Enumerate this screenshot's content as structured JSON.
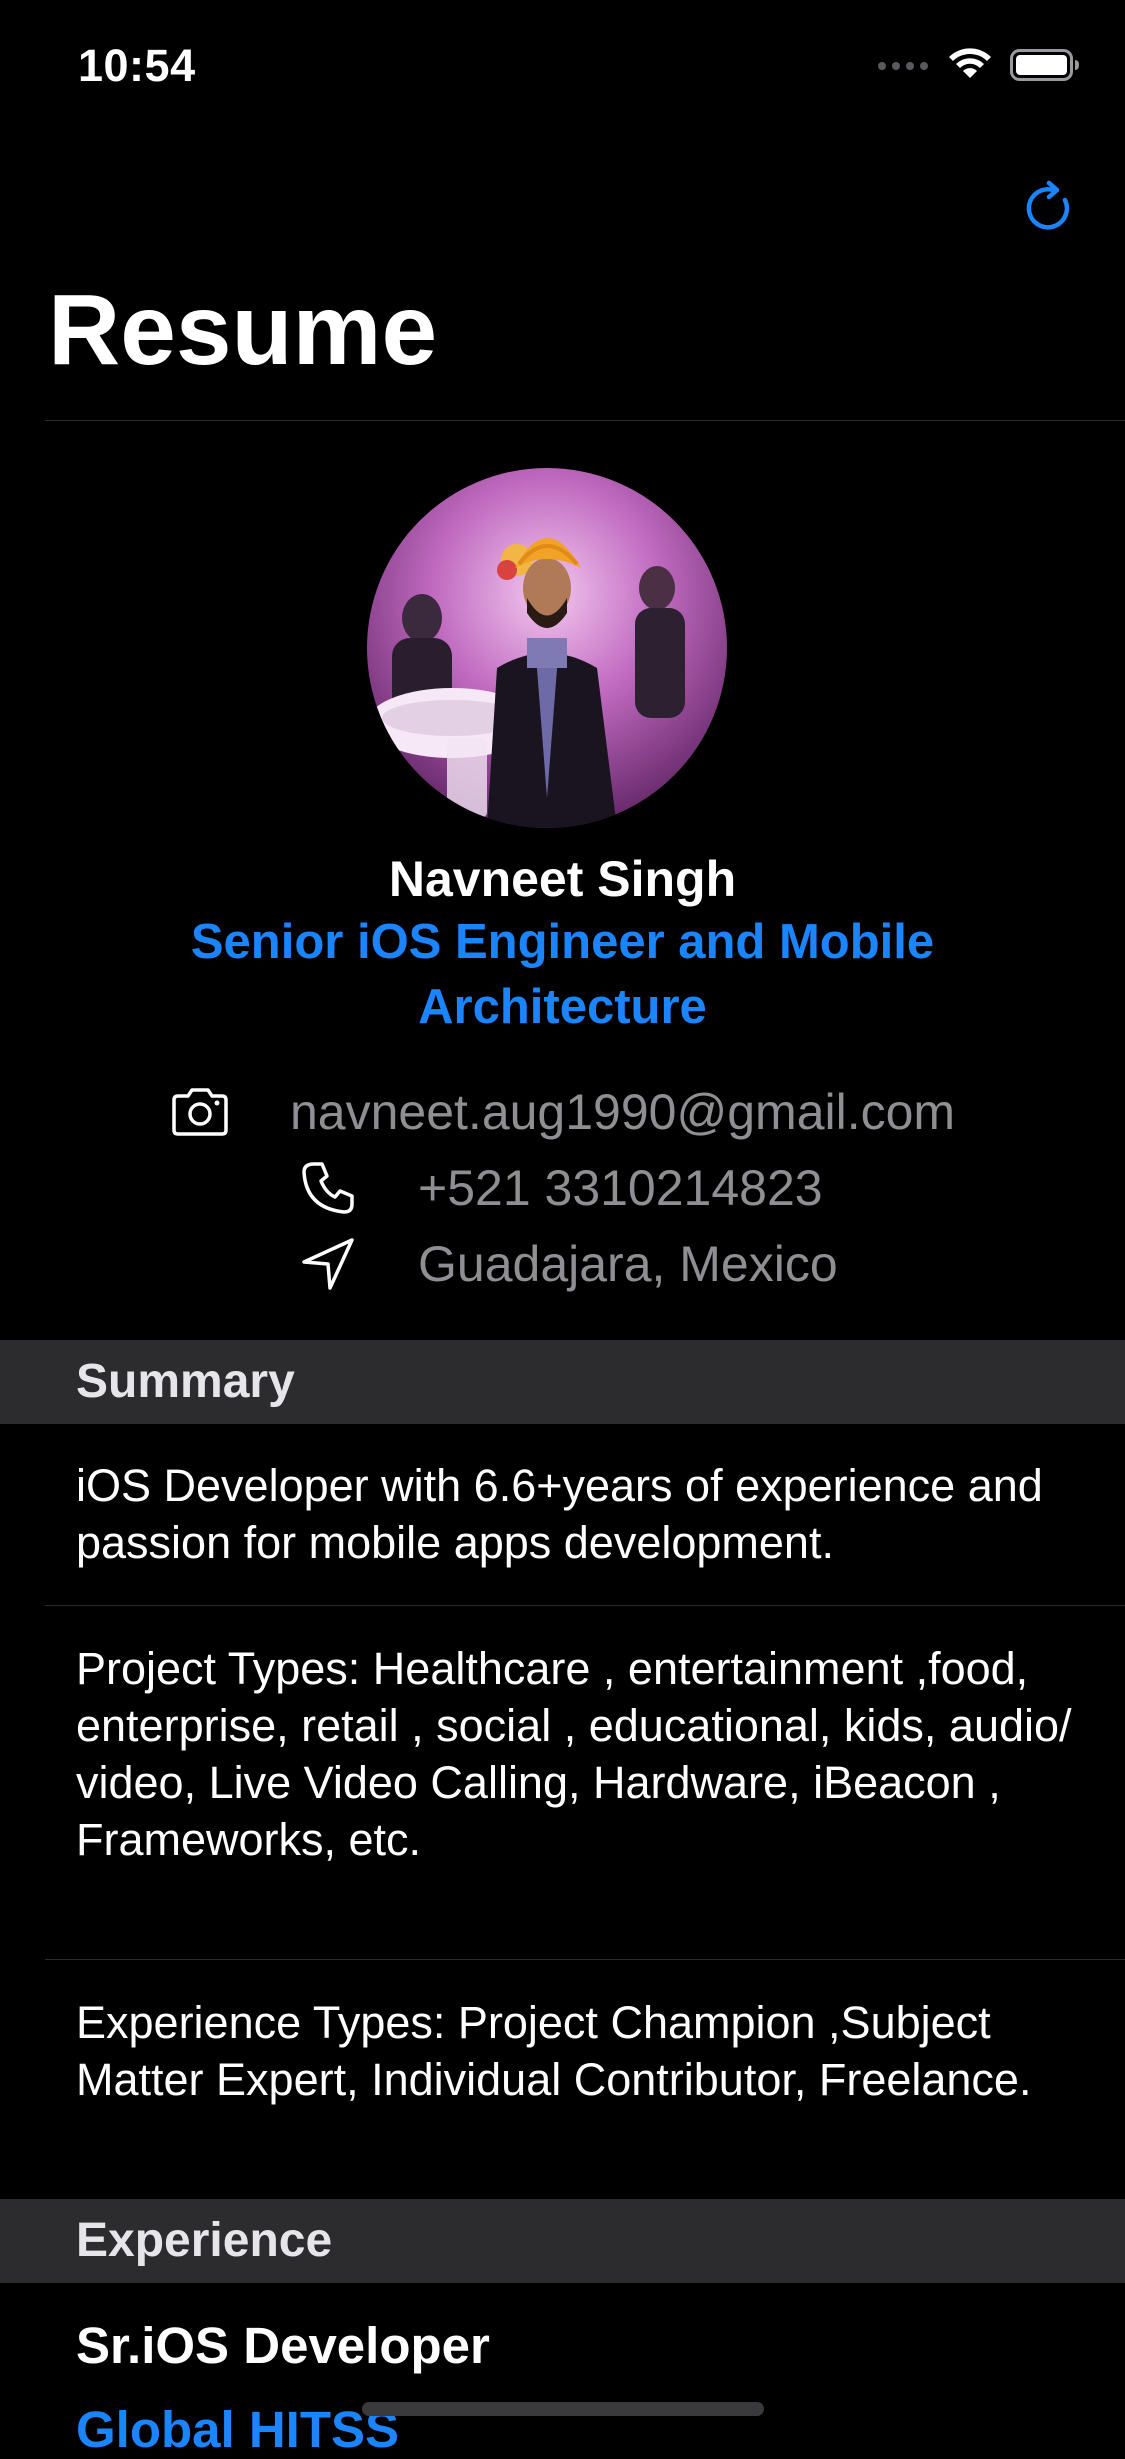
{
  "status_bar": {
    "time": "10:54"
  },
  "nav": {
    "title": "Resume",
    "refresh_icon": "refresh-icon"
  },
  "profile": {
    "name": "Navneet Singh",
    "title": "Senior iOS Engineer and Mobile Architecture",
    "contacts": [
      {
        "icon": "camera-icon",
        "text": "navneet.aug1990@gmail.com"
      },
      {
        "icon": "phone-icon",
        "text": "+521 3310214823"
      },
      {
        "icon": "location-arrow-icon",
        "text": "Guadajara, Mexico"
      }
    ]
  },
  "summary": {
    "header": "Summary",
    "items": [
      "iOS Developer with 6.6+years of experience and passion for mobile apps development.",
      "Project Types: Healthcare , entertainment ,food, enterprise, retail , social , educational, kids, audio/ video, Live Video Calling, Hardware, iBeacon , Frameworks, etc.",
      "Experience Types: Project Champion ,Subject Matter Expert, Individual Contributor, Freelance."
    ]
  },
  "experience": {
    "header": "Experience",
    "items": [
      {
        "title": "Sr.iOS Developer",
        "company": "Global HITSS"
      }
    ]
  },
  "colors": {
    "accent": "#1b84ff",
    "background": "#000000",
    "section_header_bg": "#2c2c2e",
    "secondary_text": "#8e8e93"
  }
}
